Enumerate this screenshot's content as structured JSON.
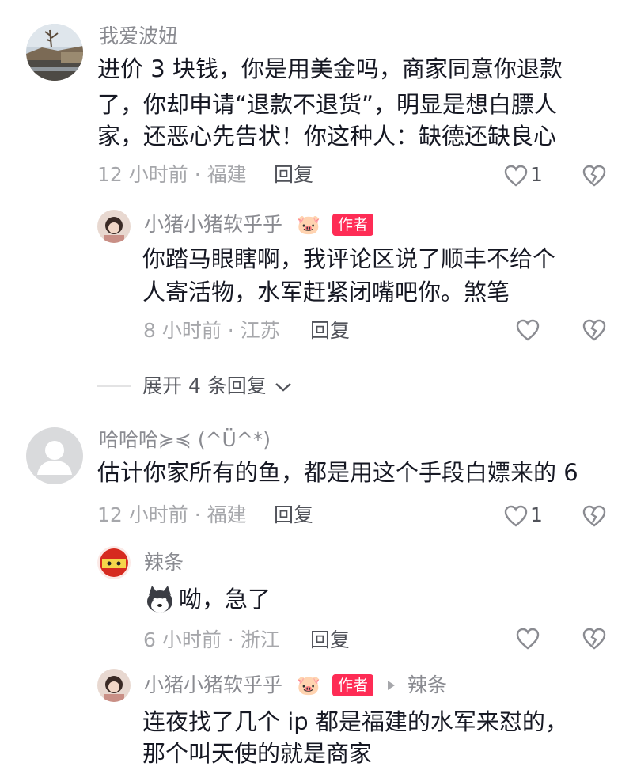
{
  "comments": [
    {
      "username": "我爱波妞",
      "text_lines": [
        "进价 3 块钱，你是用美金吗，商家同意你退款",
        "了，你却申请“退款不退货”，明显是想白膘人",
        "家，还恶心先告状！你这种人：缺德还缺良心"
      ],
      "meta": "12 小时前 · 福建",
      "reply_label": "回复",
      "like_count": "1",
      "replies": [
        {
          "username": "小猪小猪软乎乎",
          "name_emoji": "🐷",
          "badge": "作者",
          "text_lines": [
            "你踏马眼瞎啊，我评论区说了顺丰不给个",
            "人寄活物，水军赶紧闭嘴吧你。煞笔"
          ],
          "meta": "8 小时前 · 江苏",
          "reply_label": "回复"
        }
      ],
      "expand_label": "展开 4 条回复"
    },
    {
      "username": "哈哈哈≽≼ (^Ü^*)",
      "text_lines": [
        "估计你家所有的鱼，都是用这个手段白嫖来的 6"
      ],
      "meta": "12 小时前 · 福建",
      "reply_label": "回复",
      "like_count": "1",
      "replies": [
        {
          "username": "辣条",
          "text_lines": [
            "呦，急了"
          ],
          "meta": "6 小时前 · 浙江",
          "reply_label": "回复"
        },
        {
          "username": "小猪小猪软乎乎",
          "name_emoji": "🐷",
          "badge": "作者",
          "reply_to": "辣条",
          "text_lines": [
            "连夜找了几个 ip 都是福建的水军来怼的，",
            "那个叫天使的就是商家"
          ]
        }
      ]
    }
  ],
  "colors": {
    "text": "#161823",
    "secondary": "#8a8b91",
    "badge": "#fe2c55",
    "meta": "#a6a7ab"
  }
}
